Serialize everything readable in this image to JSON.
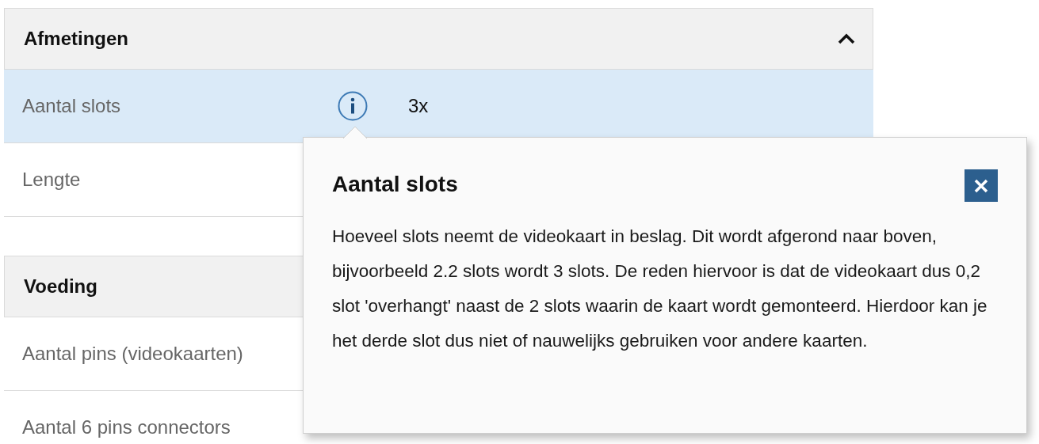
{
  "sections": [
    {
      "title": "Afmetingen",
      "expanded": true,
      "rows": [
        {
          "label": "Aantal slots",
          "value": "3x",
          "info": true,
          "selected": true
        },
        {
          "label": "Lengte",
          "info": false,
          "selected": false
        }
      ]
    },
    {
      "title": "Voeding",
      "rows": [
        {
          "label": "Aantal pins (videokaarten)",
          "info": false,
          "selected": false
        },
        {
          "label": "Aantal 6 pins connectors",
          "info": false,
          "selected": false
        }
      ]
    }
  ],
  "popover": {
    "title": "Aantal slots",
    "body": "Hoeveel slots neemt de videokaart in beslag. Dit wordt afgerond naar boven, bijvoorbeeld 2.2 slots wordt 3 slots. De reden hiervoor is dat de videokaart dus 0,2 slot 'overhangt' naast de 2 slots waarin de kaart wordt gemonteerd. Hierdoor kan je het derde slot dus niet of nauwelijks gebruiken voor andere kaarten."
  }
}
